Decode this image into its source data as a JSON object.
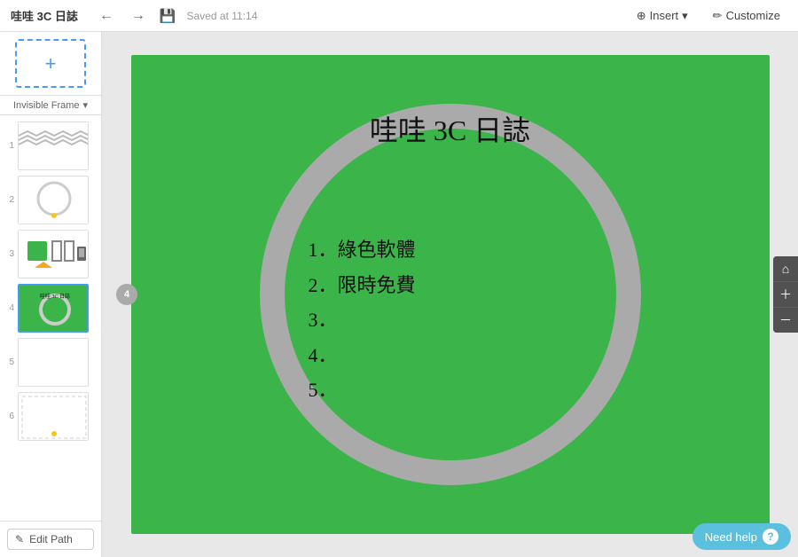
{
  "app": {
    "title": "哇哇 3C 日誌"
  },
  "topbar": {
    "saved_text": "Saved at 11:14",
    "insert_label": "Insert",
    "customize_label": "Customize",
    "back_btn": "←",
    "forward_btn": "→"
  },
  "sidebar": {
    "frame_label": "Invisible Frame",
    "frame_dropdown": "▾",
    "add_frame_icon": "+",
    "edit_path_label": "Edit Path",
    "edit_path_icon": "✎"
  },
  "slides": [
    {
      "number": "1",
      "active": false
    },
    {
      "number": "2",
      "active": false
    },
    {
      "number": "3",
      "active": false
    },
    {
      "number": "4",
      "active": true
    },
    {
      "number": "5",
      "active": false
    },
    {
      "number": "6",
      "active": false
    }
  ],
  "canvas": {
    "slide4": {
      "title": "哇哇 3C 日誌",
      "list_items": [
        "1．綠色軟體",
        "2．限時免費",
        "3．",
        "4．",
        "5．"
      ],
      "badge_number": "4"
    }
  },
  "zoom": {
    "home_icon": "⌂",
    "zoom_in_icon": "＋",
    "zoom_out_icon": "－"
  },
  "help": {
    "label": "Need help",
    "icon": "?"
  }
}
